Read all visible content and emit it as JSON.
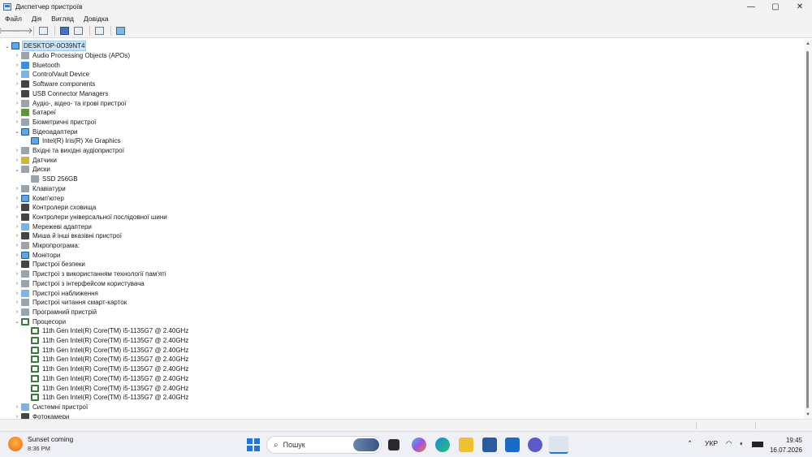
{
  "window": {
    "title": "Диспетчер пристроїв",
    "controls": {
      "minimize": "—",
      "maximize": "▢",
      "close": "✕"
    }
  },
  "menu": [
    "Файл",
    "Дія",
    "Вигляд",
    "Довідка"
  ],
  "tree": {
    "root": "DESKTOP-0O39NT4",
    "items": [
      {
        "label": "Audio Processing Objects (APOs)",
        "level": 1,
        "expanded": false,
        "icon": "speaker-icon",
        "color": "gray"
      },
      {
        "label": "Bluetooth",
        "level": 1,
        "expanded": false,
        "icon": "bluetooth-icon",
        "color": "blue"
      },
      {
        "label": "ControlVault Device",
        "level": 1,
        "expanded": false,
        "icon": "controlvault-icon",
        "color": "lblue"
      },
      {
        "label": "Software components",
        "level": 1,
        "expanded": false,
        "icon": "software-components-icon",
        "color": "dark"
      },
      {
        "label": "USB Connector Managers",
        "level": 1,
        "expanded": false,
        "icon": "usb-icon",
        "color": "dark"
      },
      {
        "label": "Аудіо-, відео- та ігрові пристрої",
        "level": 1,
        "expanded": false,
        "icon": "audio-video-icon",
        "color": "gray"
      },
      {
        "label": "Батареї",
        "level": 1,
        "expanded": false,
        "icon": "battery-icon",
        "color": "green"
      },
      {
        "label": "Біометричні пристрої",
        "level": 1,
        "expanded": false,
        "icon": "biometric-icon",
        "color": "gray"
      },
      {
        "label": "Відеоадаптери",
        "level": 1,
        "expanded": true,
        "icon": "display-adapter-icon",
        "color": "mon"
      },
      {
        "label": "Intel(R) Iris(R) Xe Graphics",
        "level": 2,
        "icon": "display-adapter-icon",
        "color": "mon"
      },
      {
        "label": "Вхідні та вихідні аудіопристрої",
        "level": 1,
        "expanded": false,
        "icon": "speaker-icon",
        "color": "gray"
      },
      {
        "label": "Датчики",
        "level": 1,
        "expanded": false,
        "icon": "sensor-icon",
        "color": "yellow"
      },
      {
        "label": "Диски",
        "level": 1,
        "expanded": true,
        "icon": "disk-icon",
        "color": "gray"
      },
      {
        "label": "SSD 256GB",
        "level": 2,
        "icon": "disk-icon",
        "color": "gray"
      },
      {
        "label": "Клавіатури",
        "level": 1,
        "expanded": false,
        "icon": "keyboard-icon",
        "color": "gray"
      },
      {
        "label": "Комп'ютер",
        "level": 1,
        "expanded": false,
        "icon": "computer-icon",
        "color": "mon"
      },
      {
        "label": "Контролери сховища",
        "level": 1,
        "expanded": false,
        "icon": "storage-controller-icon",
        "color": "dark"
      },
      {
        "label": "Контролери універсальної послідовної шини",
        "level": 1,
        "expanded": false,
        "icon": "usb-icon",
        "color": "dark"
      },
      {
        "label": "Мережеві адаптери",
        "level": 1,
        "expanded": false,
        "icon": "network-icon",
        "color": "lblue"
      },
      {
        "label": "Миша й інші вказівні пристрої",
        "level": 1,
        "expanded": false,
        "icon": "mouse-icon",
        "color": "dark"
      },
      {
        "label": "Мікропрограма:",
        "level": 1,
        "expanded": false,
        "icon": "firmware-icon",
        "color": "gray"
      },
      {
        "label": "Монітори",
        "level": 1,
        "expanded": false,
        "icon": "monitor-icon",
        "color": "mon"
      },
      {
        "label": "Пристрої безпеки",
        "level": 1,
        "expanded": false,
        "icon": "security-icon",
        "color": "dark"
      },
      {
        "label": "Пристрої з використанням технології пам'яті",
        "level": 1,
        "expanded": false,
        "icon": "memory-icon",
        "color": "gray"
      },
      {
        "label": "Пристрої з інтерфейсом користувача",
        "level": 1,
        "expanded": false,
        "icon": "hid-icon",
        "color": "gray"
      },
      {
        "label": "Пристрої наближення",
        "level": 1,
        "expanded": false,
        "icon": "proximity-icon",
        "color": "lblue"
      },
      {
        "label": "Пристрої читання смарт-карток",
        "level": 1,
        "expanded": false,
        "icon": "smartcard-icon",
        "color": "gray"
      },
      {
        "label": "Програмний пристрій",
        "level": 1,
        "expanded": false,
        "icon": "software-device-icon",
        "color": "gray"
      },
      {
        "label": "Процесори",
        "level": 1,
        "expanded": true,
        "icon": "processor-icon",
        "color": "chip"
      },
      {
        "label": "11th Gen Intel(R) Core(TM) i5-1135G7 @ 2.40GHz",
        "level": 2,
        "icon": "processor-icon",
        "color": "chip"
      },
      {
        "label": "11th Gen Intel(R) Core(TM) i5-1135G7 @ 2.40GHz",
        "level": 2,
        "icon": "processor-icon",
        "color": "chip"
      },
      {
        "label": "11th Gen Intel(R) Core(TM) i5-1135G7 @ 2.40GHz",
        "level": 2,
        "icon": "processor-icon",
        "color": "chip"
      },
      {
        "label": "11th Gen Intel(R) Core(TM) i5-1135G7 @ 2.40GHz",
        "level": 2,
        "icon": "processor-icon",
        "color": "chip"
      },
      {
        "label": "11th Gen Intel(R) Core(TM) i5-1135G7 @ 2.40GHz",
        "level": 2,
        "icon": "processor-icon",
        "color": "chip"
      },
      {
        "label": "11th Gen Intel(R) Core(TM) i5-1135G7 @ 2.40GHz",
        "level": 2,
        "icon": "processor-icon",
        "color": "chip"
      },
      {
        "label": "11th Gen Intel(R) Core(TM) i5-1135G7 @ 2.40GHz",
        "level": 2,
        "icon": "processor-icon",
        "color": "chip"
      },
      {
        "label": "11th Gen Intel(R) Core(TM) i5-1135G7 @ 2.40GHz",
        "level": 2,
        "icon": "processor-icon",
        "color": "chip"
      },
      {
        "label": "Системні пристрої",
        "level": 1,
        "expanded": false,
        "icon": "system-devices-icon",
        "color": "lblue"
      },
      {
        "label": "Фотокамери",
        "level": 1,
        "expanded": false,
        "icon": "camera-icon",
        "color": "dark"
      }
    ]
  },
  "taskbar": {
    "weather_title": "Sunset coming",
    "weather_time": "8:36 PM",
    "search_placeholder": "Пошук",
    "language": "УКР",
    "time": "19:45",
    "date": "16.07.2026"
  },
  "colors": {
    "selection": "#cce4f7",
    "start_blue": "#1a78d8"
  }
}
